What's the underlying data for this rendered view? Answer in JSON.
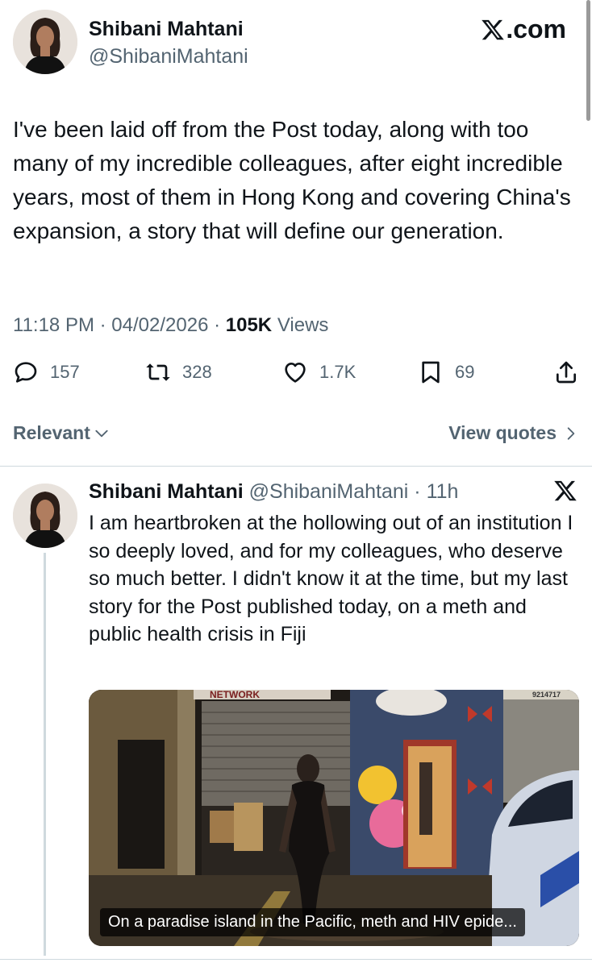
{
  "tweet": {
    "author_name": "Shibani Mahtani",
    "author_handle": "@ShibaniMahtani",
    "brand_text": ".com",
    "text": "I've been laid off from the Post today, along with too many of my incredible colleagues, after eight incredible years, most of them in Hong Kong and covering China's expansion, a story that will define our generation.",
    "time": "11:18 PM",
    "date": "04/02/2026",
    "views_count": "105K",
    "views_label": "Views",
    "replies": "157",
    "reposts": "328",
    "likes": "1.7K",
    "bookmarks": "69"
  },
  "sort": {
    "relevant_label": "Relevant",
    "view_quotes_label": "View quotes"
  },
  "reply": {
    "author_name": "Shibani Mahtani",
    "author_handle": "@ShibaniMahtani",
    "time": "11h",
    "text": "I am heartbroken at the hollowing out of an institution I so deeply loved, and for my colleagues, who deserve so much better. I didn't know it at the time, but my last story for the Post published today, on a meth and public health crisis in Fiji",
    "media_caption": "On a paradise island in the Pacific, meth and HIV epide...",
    "media_sign_text": "NETWORK",
    "media_plate_text": "9214717"
  },
  "colors": {
    "text_primary": "#0f1419",
    "text_secondary": "#536471",
    "divider": "#cfd9de"
  }
}
